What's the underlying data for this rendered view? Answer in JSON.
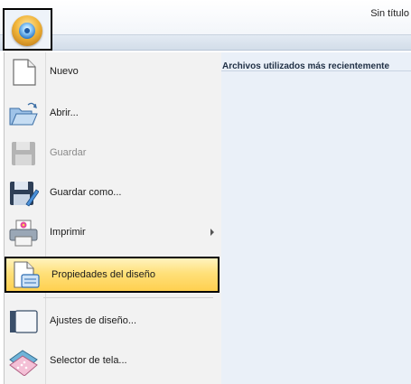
{
  "window": {
    "title": "Sin título"
  },
  "recent": {
    "title": "Archivos utilizados más recientemente"
  },
  "menu": {
    "items": [
      {
        "label": "Nuevo",
        "icon": "new-document-icon",
        "enabled": true
      },
      {
        "label": "Abrir...",
        "icon": "open-folder-icon",
        "enabled": true
      },
      {
        "label": "Guardar",
        "icon": "save-disk-icon",
        "enabled": false
      },
      {
        "label": "Guardar como...",
        "icon": "save-as-icon",
        "enabled": true
      },
      {
        "label": "Imprimir",
        "icon": "printer-icon",
        "enabled": true,
        "submenu": true
      },
      {
        "label": "Propiedades del diseño",
        "icon": "design-properties-icon",
        "enabled": true,
        "selected": true
      },
      {
        "label": "Ajustes de diseño...",
        "icon": "design-settings-icon",
        "enabled": true
      },
      {
        "label": "Selector de tela...",
        "icon": "fabric-selector-icon",
        "enabled": true
      }
    ]
  },
  "colors": {
    "highlight": "#ffd04f",
    "ribbon": "#d3dde9",
    "menu_bg": "#f2f2f2",
    "recent_bg": "#eaf0f8"
  }
}
